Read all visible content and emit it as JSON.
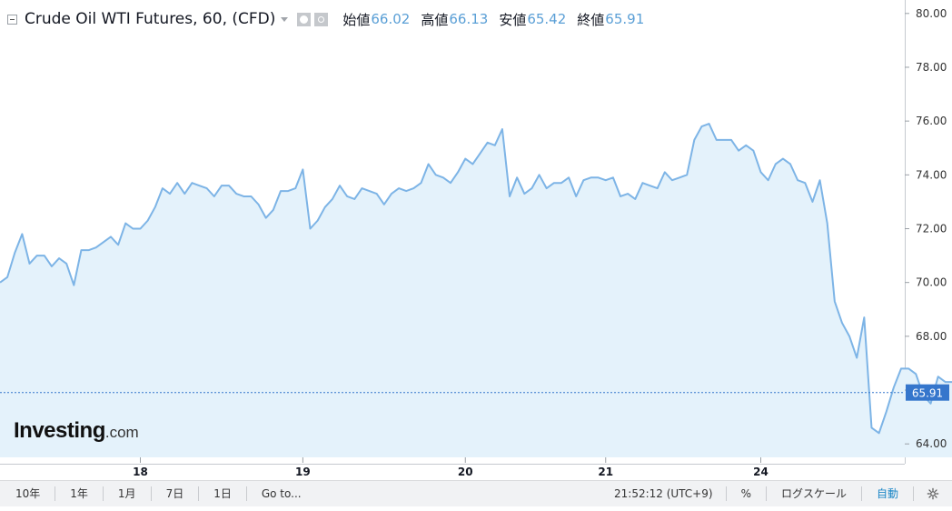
{
  "header": {
    "symbol": "Crude Oil WTI Futures, 60, (CFD)",
    "open_label": "始値",
    "open_value": "66.02",
    "high_label": "高値",
    "high_value": "66.13",
    "low_label": "安値",
    "low_value": "65.42",
    "close_label": "終値",
    "close_value": "65.91"
  },
  "logo": {
    "brand": "Investing",
    "tld": ".com"
  },
  "toolbar": {
    "buttons": [
      "10年",
      "1年",
      "1月",
      "7日",
      "1日",
      "Go to..."
    ],
    "time": "21:52:12 (UTC+9)",
    "percent": "%",
    "log_scale": "ログスケール",
    "auto": "自動"
  },
  "colors": {
    "line": "#7db4e6",
    "fill": "#e4f2fb",
    "price_tag": "#3576cc",
    "axis_text": "#333333"
  },
  "chart_data": {
    "type": "area",
    "title": "Crude Oil WTI Futures, 60, (CFD)",
    "x_labels": [
      {
        "label": "18",
        "x": 19
      },
      {
        "label": "19",
        "x": 41
      },
      {
        "label": "20",
        "x": 63
      },
      {
        "label": "21",
        "x": 82
      },
      {
        "label": "24",
        "x": 103
      }
    ],
    "x_range": [
      0,
      122
    ],
    "ylim": [
      63.5,
      80.5
    ],
    "y_ticks": [
      "64.00",
      "66.00",
      "68.00",
      "70.00",
      "72.00",
      "74.00",
      "76.00",
      "78.00",
      "80.00"
    ],
    "y_tick_values": [
      64,
      66,
      68,
      70,
      72,
      74,
      76,
      78,
      80
    ],
    "last_price": "65.91",
    "last_price_value": 65.91,
    "values": [
      70.0,
      70.2,
      71.1,
      71.8,
      70.7,
      71.0,
      71.0,
      70.6,
      70.9,
      70.7,
      69.9,
      71.2,
      71.2,
      71.3,
      71.5,
      71.7,
      71.4,
      72.2,
      72.0,
      72.0,
      72.3,
      72.8,
      73.5,
      73.3,
      73.7,
      73.3,
      73.7,
      73.6,
      73.5,
      73.2,
      73.6,
      73.6,
      73.3,
      73.2,
      73.2,
      72.9,
      72.4,
      72.7,
      73.4,
      73.4,
      73.5,
      74.2,
      72.0,
      72.3,
      72.8,
      73.1,
      73.6,
      73.2,
      73.1,
      73.5,
      73.4,
      73.3,
      72.9,
      73.3,
      73.5,
      73.4,
      73.5,
      73.7,
      74.4,
      74.0,
      73.9,
      73.7,
      74.1,
      74.6,
      74.4,
      74.8,
      75.2,
      75.1,
      75.7,
      73.2,
      73.9,
      73.3,
      73.5,
      74.0,
      73.5,
      73.7,
      73.7,
      73.9,
      73.2,
      73.8,
      73.9,
      73.9,
      73.8,
      73.9,
      73.2,
      73.3,
      73.1,
      73.7,
      73.6,
      73.5,
      74.1,
      73.8,
      73.9,
      74.0,
      75.3,
      75.8,
      75.9,
      75.3,
      75.3,
      75.3,
      74.9,
      75.1,
      74.9,
      74.1,
      73.8,
      74.4,
      74.6,
      74.4,
      73.8,
      73.7,
      73.0,
      73.8,
      72.2,
      69.3,
      68.5,
      68.0,
      67.2,
      68.7,
      64.6,
      64.4,
      65.2,
      66.1,
      66.8,
      66.8,
      66.6,
      65.8,
      65.5,
      66.5,
      66.3,
      66.3,
      66.6,
      66.1,
      65.9
    ]
  }
}
